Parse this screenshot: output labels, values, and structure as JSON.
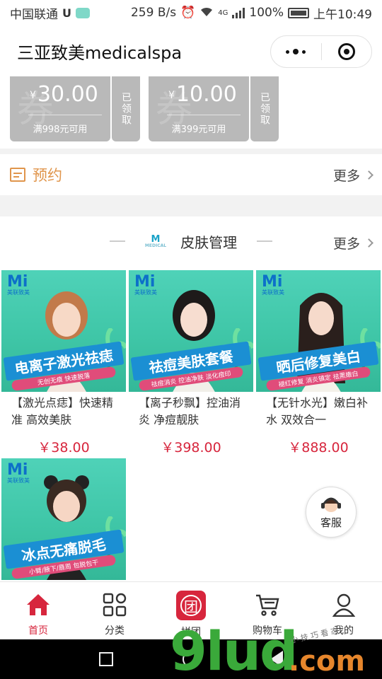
{
  "status_bar": {
    "carrier": "中国联通",
    "carrier_icon": "U",
    "speed": "259 B/s",
    "network": "4G",
    "battery": "100%",
    "time": "上午10:49"
  },
  "header": {
    "title": "三亚致美medicalspa"
  },
  "coupons": [
    {
      "currency": "¥",
      "amount": "30.00",
      "condition": "满998元可用",
      "status": "已领取",
      "watermark": "券"
    },
    {
      "currency": "¥",
      "amount": "10.00",
      "condition": "满399元可用",
      "status": "已领取",
      "watermark": "券"
    }
  ],
  "booking": {
    "label": "预约",
    "more": "更多"
  },
  "section": {
    "title": "皮肤管理",
    "more": "更多",
    "logo_mark": "M",
    "logo_sub": "MEDICAL"
  },
  "products": [
    {
      "brand": "Mi",
      "brand_sub": "美联致美",
      "banner": "电离子激光祛痣",
      "tagline": "无创无痕 快速脱落",
      "name": "【激光点痣】快速精准 高效美肤",
      "price": "￥38.00"
    },
    {
      "brand": "Mi",
      "brand_sub": "美联致美",
      "banner": "祛痘美肤套餐",
      "tagline": "祛痘消炎 控油净肤 淡化痘印",
      "name": "【离子秒飘】控油消炎 净痘靓肤",
      "price": "￥398.00"
    },
    {
      "brand": "Mi",
      "brand_sub": "美联致美",
      "banner": "晒后修复美白",
      "tagline": "褪红修复 消炎镇定 祛黑嫩白",
      "name": "【无针水光】嫩白补水 双效合一",
      "price": "￥888.00"
    },
    {
      "brand": "Mi",
      "brand_sub": "美联致美",
      "banner": "冰点无痛脱毛",
      "tagline": "小臂/腋下/唇周 包脱包干",
      "name": "",
      "price": ""
    }
  ],
  "customer_service": {
    "label": "客服"
  },
  "tabbar": {
    "items": [
      {
        "label": "首页",
        "icon": "home-icon",
        "active": true
      },
      {
        "label": "分类",
        "icon": "category-icon",
        "active": false
      },
      {
        "label": "拼团",
        "icon": "group-buy-icon",
        "active": false
      },
      {
        "label": "购物车",
        "icon": "cart-icon",
        "active": false
      },
      {
        "label": "我的",
        "icon": "profile-icon",
        "active": false
      }
    ],
    "group_glyph": "团"
  },
  "watermark": {
    "text": "9lud",
    "com": ".com",
    "tiny": "小 技 巧 看 态"
  },
  "colors": {
    "accent": "#d7263d",
    "booking": "#e0954b",
    "coupon_bg": "#b9b9b9",
    "thumb_bg": "#3fc6a7"
  }
}
